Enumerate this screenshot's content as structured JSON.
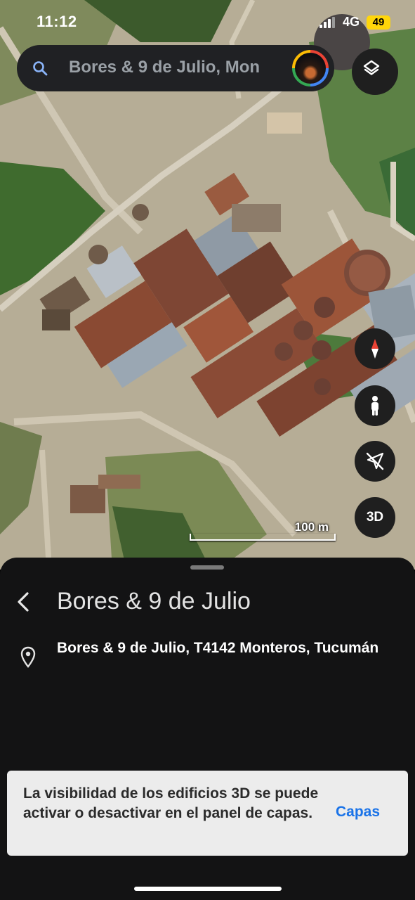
{
  "status_bar": {
    "time": "11:12",
    "network": "4G",
    "battery": "49"
  },
  "search": {
    "query": "Bores & 9 de Julio, Mon"
  },
  "map": {
    "scale_label": "100 m",
    "button_3d": "3D"
  },
  "place": {
    "title": "Bores & 9 de Julio",
    "address": "Bores & 9 de Julio, T4142 Monteros, Tucumán"
  },
  "toast": {
    "message": "La visibilidad de los edificios 3D se puede activar o desactivar en el panel de capas.",
    "action_label": "Capas"
  },
  "colors": {
    "sheet_bg": "#131314",
    "toast_bg": "#ececec",
    "accent": "#1a73e8",
    "battery": "#ffd60a"
  },
  "icons": [
    "search-icon",
    "layers-icon",
    "compass-icon",
    "pegman-icon",
    "location-off-icon",
    "back-arrow-icon",
    "location-pin-icon",
    "signal-icon"
  ]
}
